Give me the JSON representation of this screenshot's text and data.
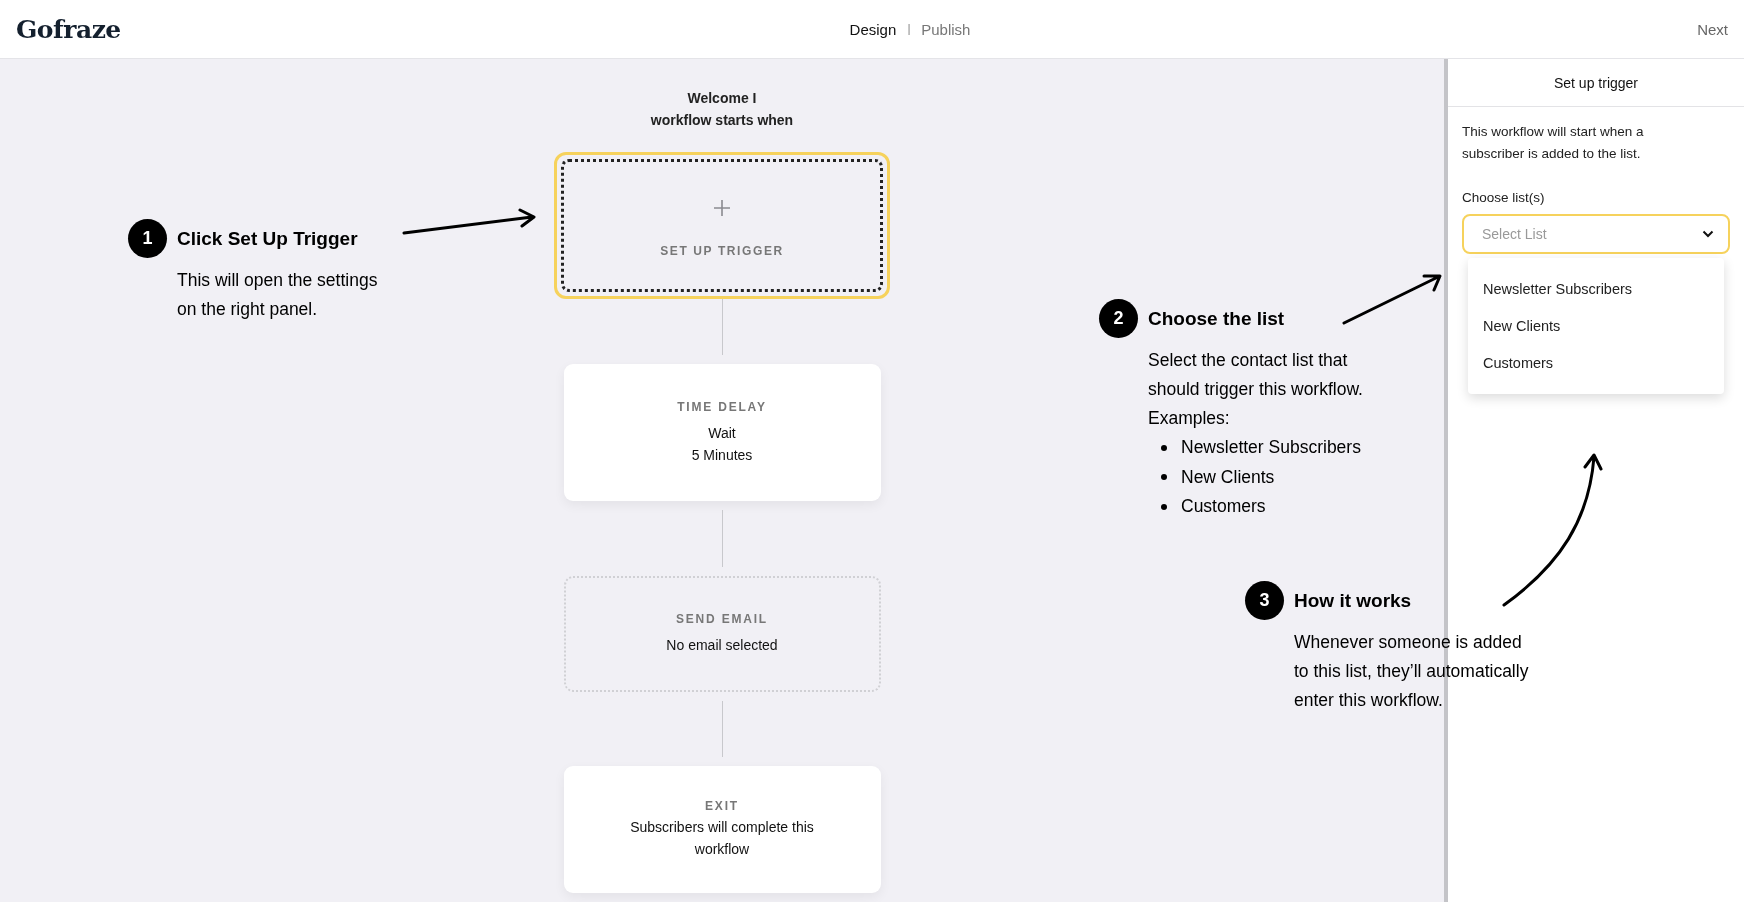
{
  "header": {
    "logo": "Gofraze",
    "tabs": [
      {
        "label": "Design",
        "selected": true
      },
      {
        "label": "Publish",
        "selected": false
      }
    ],
    "next_button": "Next"
  },
  "workflow": {
    "title_lines": [
      "Welcome I",
      "workflow starts when"
    ],
    "steps": [
      {
        "kind": "trigger",
        "label": "SET UP TRIGGER",
        "highlighted": true
      },
      {
        "kind": "card",
        "label": "TIME DELAY",
        "detail_lines": [
          "Wait",
          "5 Minutes"
        ]
      },
      {
        "kind": "placeholder",
        "label": "SEND EMAIL",
        "detail_lines": [
          "No email selected"
        ]
      },
      {
        "kind": "card",
        "label": "EXIT",
        "detail_lines": [
          "Subscribers will complete this",
          "workflow"
        ]
      }
    ]
  },
  "panel": {
    "title": "Set up trigger",
    "description": "This workflow will start when a subscriber is added to the list.",
    "field_label": "Choose list(s)",
    "select": {
      "placeholder": "Select List",
      "highlighted": true,
      "expanded": true
    },
    "options": [
      {
        "label": "Newsletter Subscribers",
        "selected": false
      },
      {
        "label": "New Clients",
        "selected": false
      },
      {
        "label": "Customers",
        "selected": false
      }
    ]
  },
  "annotations": [
    {
      "number": "1",
      "title": "Click Set Up Trigger",
      "body_lines": [
        "This will open the settings",
        "on the right panel."
      ]
    },
    {
      "number": "2",
      "title": "Choose the list",
      "body_lines": [
        "Select the contact list that",
        "should trigger this workflow.",
        "Examples:"
      ],
      "bullets": [
        "Newsletter Subscribers",
        "New Clients",
        "Customers"
      ]
    },
    {
      "number": "3",
      "title": "How it works",
      "body_lines": [
        "Whenever someone is added",
        "to this list, they’ll automatically",
        "enter this workflow."
      ]
    }
  ]
}
